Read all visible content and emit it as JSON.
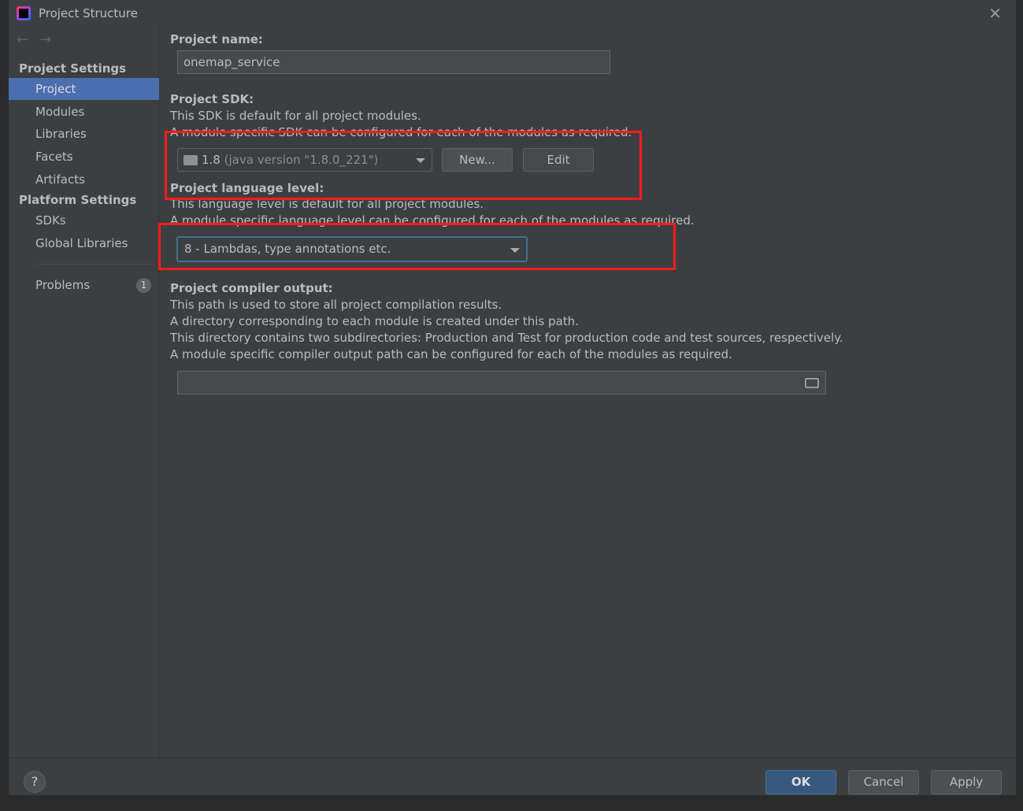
{
  "window": {
    "title": "Project Structure"
  },
  "sidebar": {
    "project_settings": "Project Settings",
    "project_items": [
      {
        "label": "Project",
        "selected": true
      },
      {
        "label": "Modules"
      },
      {
        "label": "Libraries"
      },
      {
        "label": "Facets"
      },
      {
        "label": "Artifacts"
      }
    ],
    "platform_settings": "Platform Settings",
    "platform_items": [
      {
        "label": "SDKs"
      },
      {
        "label": "Global Libraries"
      }
    ],
    "problems": {
      "label": "Problems",
      "count": "1"
    }
  },
  "main": {
    "project_name_label": "Project name:",
    "project_name_value": "onemap_service",
    "sdk_label": "Project SDK:",
    "sdk_desc1": "This SDK is default for all project modules.",
    "sdk_desc2": "A module specific SDK can be configured for each of the modules as required.",
    "sdk_version": "1.8",
    "sdk_detail": "(java version \"1.8.0_221\")",
    "new_button": "New...",
    "edit_button": "Edit",
    "lang_label": "Project language level:",
    "lang_desc1": "This language level is default for all project modules.",
    "lang_desc2": "A module specific language level can be configured for each of the modules as required.",
    "lang_value": "8 - Lambdas, type annotations etc.",
    "output_label": "Project compiler output:",
    "output_desc": [
      "This path is used to store all project compilation results.",
      "A directory corresponding to each module is created under this path.",
      "This directory contains two subdirectories: Production and Test for production code and test sources, respectively.",
      "A module specific compiler output path can be configured for each of the modules as required."
    ],
    "output_value": ""
  },
  "footer": {
    "help": "?",
    "ok": "OK",
    "cancel": "Cancel",
    "apply": "Apply"
  },
  "colors": {
    "selection": "#4b6eaf",
    "highlight_box": "#ff1a1a",
    "ok_button": "#365880"
  }
}
